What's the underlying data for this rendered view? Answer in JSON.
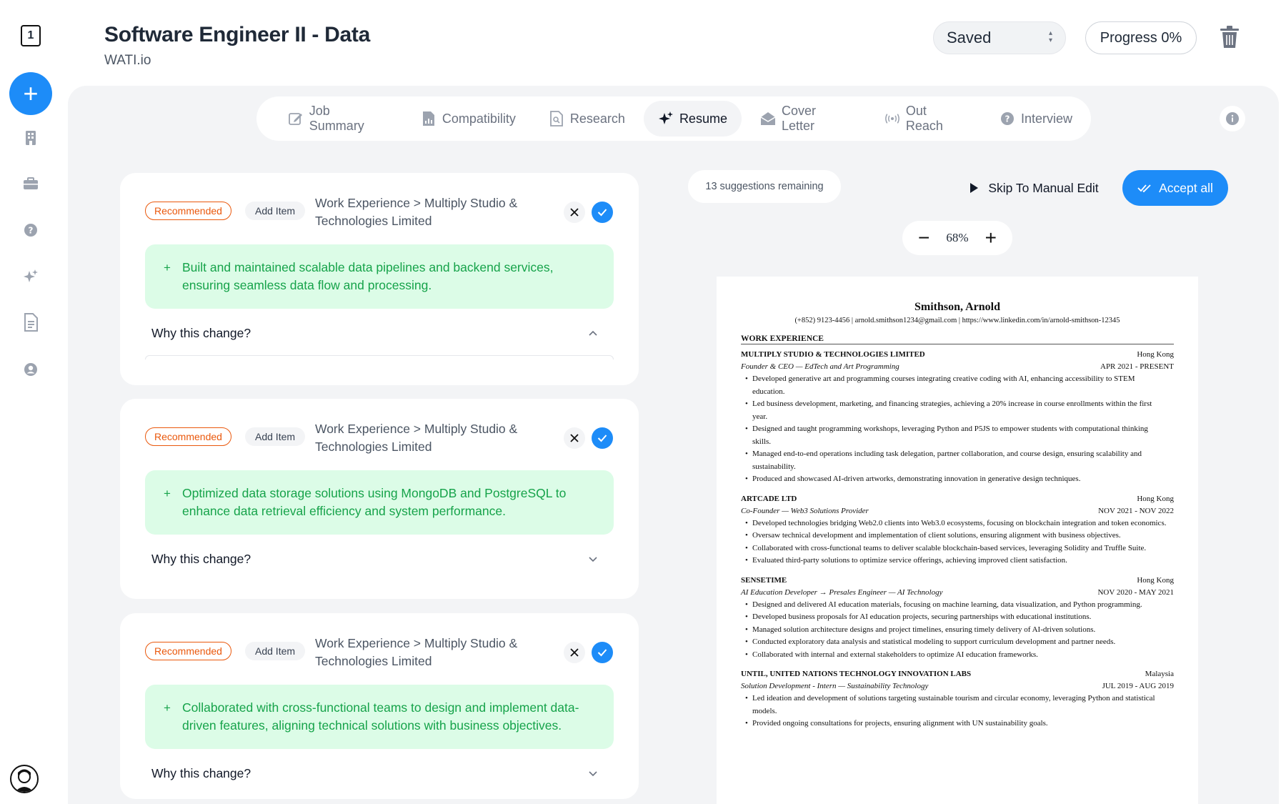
{
  "sidebar": {
    "logo_label": "1",
    "add_label": "+"
  },
  "header": {
    "title": "Software Engineer II - Data",
    "company": "WATI.io",
    "status": "Saved",
    "progress": "Progress 0%"
  },
  "tabs": [
    {
      "label": "Job Summary"
    },
    {
      "label": "Compatibility"
    },
    {
      "label": "Research"
    },
    {
      "label": "Resume"
    },
    {
      "label": "Cover Letter"
    },
    {
      "label": "Out Reach"
    },
    {
      "label": "Interview"
    }
  ],
  "suggestions": [
    {
      "badge": "Recommended",
      "action": "Add Item",
      "path": "Work Experience > Multiply Studio & Technologies Limited",
      "text": "Built and maintained scalable data pipelines and backend services, ensuring seamless data flow and processing.",
      "why": "Why this change?"
    },
    {
      "badge": "Recommended",
      "action": "Add Item",
      "path": "Work Experience > Multiply Studio & Technologies Limited",
      "text": "Optimized data storage solutions using MongoDB and PostgreSQL to enhance data retrieval efficiency and system performance.",
      "why": "Why this change?"
    },
    {
      "badge": "Recommended",
      "action": "Add Item",
      "path": "Work Experience > Multiply Studio & Technologies Limited",
      "text": "Collaborated with cross-functional teams to design and implement data-driven features, aligning technical solutions with business objectives.",
      "why": "Why this change?"
    }
  ],
  "toolbar": {
    "suggestions_remaining": "13 suggestions remaining",
    "skip_label": "Skip To Manual Edit",
    "accept_label": "Accept all",
    "zoom_level": "68%"
  },
  "resume": {
    "name": "Smithson, Arnold",
    "contact": "(+852) 9123-4456 | arnold.smithson1234@gmail.com | https://www.linkedin.com/in/arnold-smithson-12345",
    "section_title": "WORK EXPERIENCE",
    "jobs": [
      {
        "company": "MULTIPLY STUDIO & TECHNOLOGIES LIMITED",
        "location": "Hong Kong",
        "role": "Founder & CEO — EdTech and Art Programming",
        "dates": "APR 2021 - PRESENT",
        "bullets": [
          "Developed generative art and programming courses integrating creative coding with AI, enhancing accessibility to STEM education.",
          "Led business development, marketing, and financing strategies, achieving a 20% increase in course enrollments within the first year.",
          "Designed and taught programming workshops, leveraging Python and P5JS to empower students with computational thinking skills.",
          "Managed end-to-end operations including task delegation, partner collaboration, and course design, ensuring scalability and sustainability.",
          "Produced and showcased AI-driven artworks, demonstrating innovation in generative design techniques."
        ]
      },
      {
        "company": "ARTCADE LTD",
        "location": "Hong Kong",
        "role": "Co-Founder — Web3 Solutions Provider",
        "dates": "NOV 2021 - NOV 2022",
        "bullets": [
          "Developed technologies bridging Web2.0 clients into Web3.0 ecosystems, focusing on blockchain integration and token economics.",
          "Oversaw technical development and implementation of client solutions, ensuring alignment with business objectives.",
          "Collaborated with cross-functional teams to deliver scalable blockchain-based services, leveraging Solidity and Truffle Suite.",
          "Evaluated third-party solutions to optimize service offerings, achieving improved client satisfaction."
        ]
      },
      {
        "company": "SENSETIME",
        "location": "Hong Kong",
        "role": "AI Education Developer → Presales Engineer — AI Technology",
        "dates": "NOV 2020 - MAY 2021",
        "bullets": [
          "Designed and delivered AI education materials, focusing on machine learning, data visualization, and Python programming.",
          "Developed business proposals for AI education projects, securing partnerships with educational institutions.",
          "Managed solution architecture designs and project timelines, ensuring timely delivery of AI-driven solutions.",
          "Conducted exploratory data analysis and statistical modeling to support curriculum development and partner needs.",
          "Collaborated with internal and external stakeholders to optimize AI education frameworks."
        ]
      },
      {
        "company": "UNTIL, UNITED NATIONS TECHNOLOGY INNOVATION LABS",
        "location": "Malaysia",
        "role": "Solution Development - Intern — Sustainability Technology",
        "dates": "JUL 2019 - AUG 2019",
        "bullets": [
          "Led ideation and development of solutions targeting sustainable tourism and circular economy, leveraging Python and statistical models.",
          "Provided ongoing consultations for projects, ensuring alignment with UN sustainability goals."
        ]
      }
    ]
  },
  "colors": {
    "accent": "#1d8cf8",
    "recommended": "#ea580c",
    "suggestion_bg": "#dcfce7",
    "suggestion_text": "#16a34a",
    "panel_bg": "#f3f4f6"
  }
}
